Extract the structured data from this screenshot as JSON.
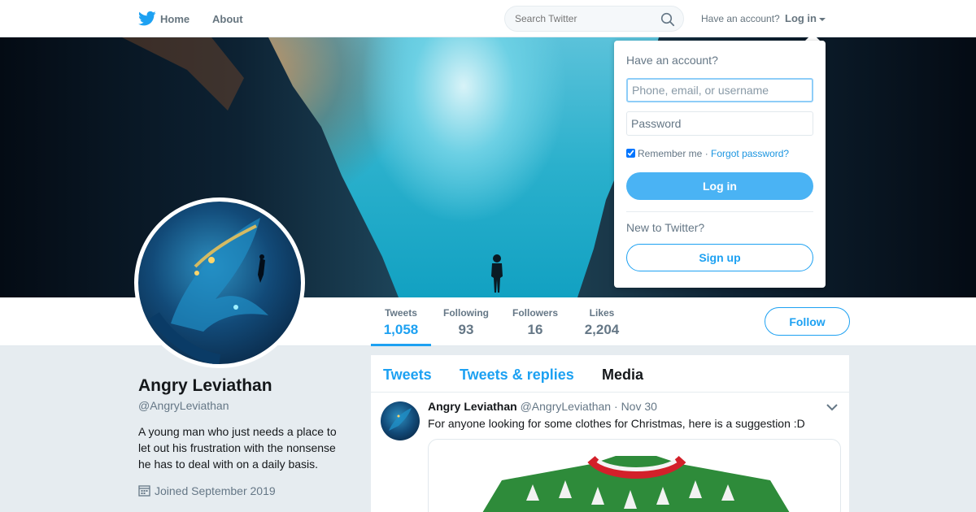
{
  "nav": {
    "home_label": "Home",
    "about_label": "About",
    "search_placeholder": "Search Twitter",
    "have_account_text": "Have an account?",
    "login_label": "Log in"
  },
  "profile": {
    "name": "Angry Leviathan",
    "handle": "@AngryLeviathan",
    "bio": "A young man who just needs a place to let out his frustration with the nonsense he has to deal with on a daily basis.",
    "joined": "Joined September 2019",
    "follow_label": "Follow"
  },
  "stats": [
    {
      "label": "Tweets",
      "value": "1,058",
      "active": true
    },
    {
      "label": "Following",
      "value": "93",
      "active": false
    },
    {
      "label": "Followers",
      "value": "16",
      "active": false
    },
    {
      "label": "Likes",
      "value": "2,204",
      "active": false
    }
  ],
  "timeline": {
    "tabs": [
      {
        "label": "Tweets"
      },
      {
        "label": "Tweets & replies"
      },
      {
        "label": "Media"
      }
    ],
    "tweet": {
      "author": "Angry Leviathan",
      "handle": "@AngryLeviathan",
      "separator": "·",
      "date": "Nov 30",
      "text": "For anyone looking for some clothes for Christmas, here is a suggestion :D"
    }
  },
  "login_dropdown": {
    "title": "Have an account?",
    "username_placeholder": "Phone, email, or username",
    "password_placeholder": "Password",
    "remember_label": "Remember me",
    "separator": "·",
    "forgot_label": "Forgot password?",
    "login_button": "Log in",
    "new_text": "New to Twitter?",
    "signup_button": "Sign up"
  },
  "colors": {
    "accent": "#1da1f2",
    "login_button_bg": "#4ab3f4",
    "page_bg": "#e6ecf0",
    "muted_text": "#657786"
  },
  "icons": [
    "twitter-bird-icon",
    "search-icon",
    "caret-down-icon",
    "calendar-icon",
    "chevron-down-icon"
  ]
}
